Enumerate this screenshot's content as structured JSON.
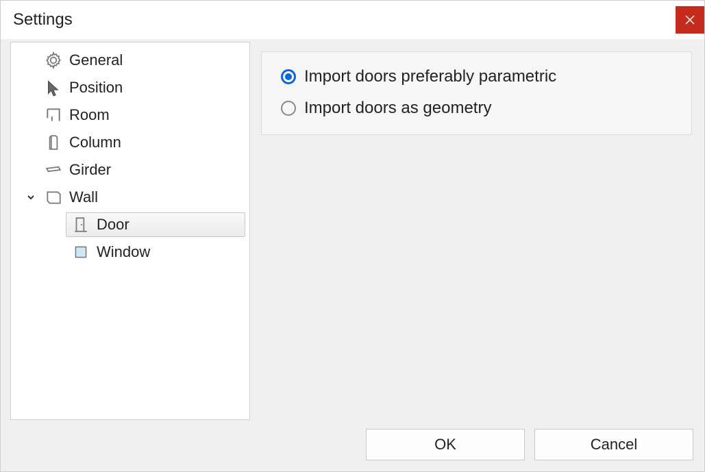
{
  "window": {
    "title": "Settings"
  },
  "sidebar": {
    "items": {
      "general": {
        "label": "General"
      },
      "position": {
        "label": "Position"
      },
      "room": {
        "label": "Room"
      },
      "column": {
        "label": "Column"
      },
      "girder": {
        "label": "Girder"
      },
      "wall": {
        "label": "Wall"
      },
      "door": {
        "label": "Door"
      },
      "window": {
        "label": "Window"
      }
    }
  },
  "panel": {
    "options": {
      "parametric": {
        "label": "Import doors preferably parametric",
        "checked": true
      },
      "geometry": {
        "label": "Import doors as geometry",
        "checked": false
      }
    }
  },
  "footer": {
    "ok": "OK",
    "cancel": "Cancel"
  }
}
